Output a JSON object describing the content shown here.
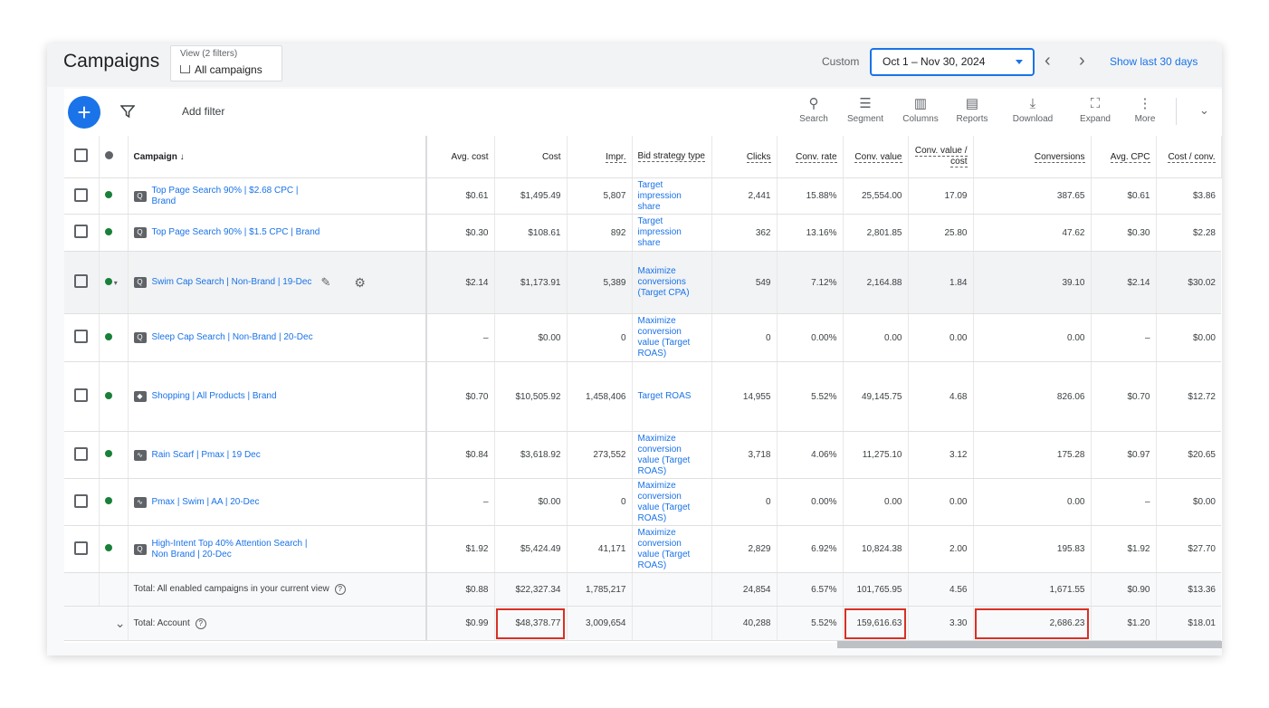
{
  "header": {
    "title": "Campaigns",
    "view_line1": "View (2 filters)",
    "view_line2": "All campaigns",
    "custom_label": "Custom",
    "date_range": "Oct 1 – Nov 30, 2024",
    "prev": "‹",
    "next": "›",
    "show_last": "Show last 30 days"
  },
  "toolbar": {
    "add_filter": "Add filter",
    "tools": [
      {
        "label": "Search",
        "icon": "search-icon",
        "glyph": "⚲"
      },
      {
        "label": "Segment",
        "icon": "segment-icon",
        "glyph": "☰"
      },
      {
        "label": "Columns",
        "icon": "columns-icon",
        "glyph": "▥"
      },
      {
        "label": "Reports",
        "icon": "reports-icon",
        "glyph": "▤"
      },
      {
        "label": "Download",
        "icon": "download-icon",
        "glyph": "⤓"
      },
      {
        "label": "Expand",
        "icon": "expand-icon",
        "glyph": "⛶"
      },
      {
        "label": "More",
        "icon": "more-icon",
        "glyph": "⋮"
      }
    ]
  },
  "table": {
    "headers": {
      "campaign": "Campaign",
      "avg_cost": "Avg. cost",
      "cost": "Cost",
      "impr": "Impr.",
      "bid_strategy": "Bid strategy type",
      "clicks": "Clicks",
      "conv_rate": "Conv. rate",
      "conv_value": "Conv. value",
      "conv_value_cost": "Conv. value / cost",
      "conversions": "Conversions",
      "avg_cpc": "Avg. CPC",
      "cost_conv": "Cost / conv."
    },
    "rows": [
      {
        "name": "Top Page Search 90% | $2.68 CPC | Brand",
        "type": "search",
        "avg_cost": "$0.61",
        "cost": "$1,495.49",
        "impr": "5,807",
        "bid": "Target impression share",
        "clicks": "2,441",
        "conv_rate": "15.88%",
        "conv_value": "25,554.00",
        "cvc": "17.09",
        "conversions": "387.65",
        "avg_cpc": "$0.61",
        "cost_conv": "$3.86"
      },
      {
        "name": "Top Page Search 90% | $1.5 CPC | Brand",
        "type": "search",
        "avg_cost": "$0.30",
        "cost": "$108.61",
        "impr": "892",
        "bid": "Target impression share",
        "clicks": "362",
        "conv_rate": "13.16%",
        "conv_value": "2,801.85",
        "cvc": "25.80",
        "conversions": "47.62",
        "avg_cpc": "$0.30",
        "cost_conv": "$2.28"
      },
      {
        "name": "Swim Cap Search | Non-Brand | 19-Dec",
        "type": "search",
        "avg_cost": "$2.14",
        "cost": "$1,173.91",
        "impr": "5,389",
        "bid": "Maximize conversions (Target CPA)",
        "clicks": "549",
        "conv_rate": "7.12%",
        "conv_value": "2,164.88",
        "cvc": "1.84",
        "conversions": "39.10",
        "avg_cpc": "$2.14",
        "cost_conv": "$30.02"
      },
      {
        "name": "Sleep Cap Search | Non-Brand | 20-Dec",
        "type": "search",
        "avg_cost": "–",
        "cost": "$0.00",
        "impr": "0",
        "bid": "Maximize conversion value (Target ROAS)",
        "clicks": "0",
        "conv_rate": "0.00%",
        "conv_value": "0.00",
        "cvc": "0.00",
        "conversions": "0.00",
        "avg_cpc": "–",
        "cost_conv": "$0.00"
      },
      {
        "name": "Shopping | All Products | Brand",
        "type": "shopping",
        "avg_cost": "$0.70",
        "cost": "$10,505.92",
        "impr": "1,458,406",
        "bid": "Target ROAS",
        "clicks": "14,955",
        "conv_rate": "5.52%",
        "conv_value": "49,145.75",
        "cvc": "4.68",
        "conversions": "826.06",
        "avg_cpc": "$0.70",
        "cost_conv": "$12.72"
      },
      {
        "name": "Rain Scarf | Pmax | 19 Dec",
        "type": "pmax",
        "avg_cost": "$0.84",
        "cost": "$3,618.92",
        "impr": "273,552",
        "bid": "Maximize conversion value (Target ROAS)",
        "clicks": "3,718",
        "conv_rate": "4.06%",
        "conv_value": "11,275.10",
        "cvc": "3.12",
        "conversions": "175.28",
        "avg_cpc": "$0.97",
        "cost_conv": "$20.65"
      },
      {
        "name": "Pmax | Swim | AA | 20-Dec",
        "type": "pmax",
        "avg_cost": "–",
        "cost": "$0.00",
        "impr": "0",
        "bid": "Maximize conversion value (Target ROAS)",
        "clicks": "0",
        "conv_rate": "0.00%",
        "conv_value": "0.00",
        "cvc": "0.00",
        "conversions": "0.00",
        "avg_cpc": "–",
        "cost_conv": "$0.00"
      },
      {
        "name": "High-Intent Top 40% Attention Search | Non Brand | 20-Dec",
        "type": "search",
        "avg_cost": "$1.92",
        "cost": "$5,424.49",
        "impr": "41,171",
        "bid": "Maximize conversion value (Target ROAS)",
        "clicks": "2,829",
        "conv_rate": "6.92%",
        "conv_value": "10,824.38",
        "cvc": "2.00",
        "conversions": "195.83",
        "avg_cpc": "$1.92",
        "cost_conv": "$27.70"
      }
    ],
    "total_view": {
      "label": "Total: All enabled campaigns in your current view",
      "avg_cost": "$0.88",
      "cost": "$22,327.34",
      "impr": "1,785,217",
      "clicks": "24,854",
      "conv_rate": "6.57%",
      "conv_value": "101,765.95",
      "cvc": "4.56",
      "conversions": "1,671.55",
      "avg_cpc": "$0.90",
      "cost_conv": "$13.36"
    },
    "total_account": {
      "label": "Total: Account",
      "avg_cost": "$0.99",
      "cost": "$48,378.77",
      "impr": "3,009,654",
      "clicks": "40,288",
      "conv_rate": "5.52%",
      "conv_value": "159,616.63",
      "cvc": "3.30",
      "conversions": "2,686.23",
      "avg_cpc": "$1.20",
      "cost_conv": "$18.01"
    }
  },
  "colors": {
    "accent": "#1a73e8",
    "enabled": "#188038",
    "highlight": "#d93025"
  }
}
